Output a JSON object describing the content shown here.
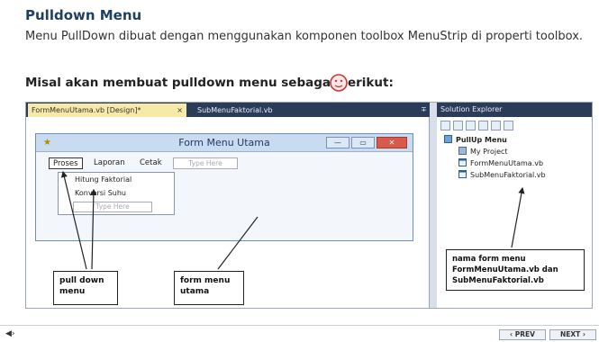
{
  "slide": {
    "title": "Pulldown Menu",
    "text": "Menu PullDown dibuat  dengan menggunakan komponen toolbox MenuStrip di properti toolbox.",
    "subheading": "Misal akan membuat pulldown menu sebagai berikut:"
  },
  "ide": {
    "tabs": [
      {
        "label": "FormMenuUtama.vb [Design]*",
        "close": "×"
      },
      {
        "label": "SubMenuFaktorial.vb"
      }
    ],
    "pin": "∓",
    "form": {
      "title": "Form Menu Utama",
      "buttons": {
        "minimize": "—",
        "maximize": "▭",
        "close": "✕"
      },
      "menubar": [
        "Proses",
        "Laporan",
        "Cetak",
        "Type Here"
      ],
      "dropdown": [
        "Hitung Faktorial",
        "Konversi Suhu",
        "Type Here"
      ]
    },
    "solution_explorer": {
      "title": "Solution Explorer",
      "project": "PullUp Menu",
      "items": [
        "My Project",
        "FormMenuUtama.vb",
        "SubMenuFaktorial.vb"
      ]
    }
  },
  "callouts": {
    "pulldown": "pull down menu",
    "form_utama": "form menu utama",
    "nama_form": "nama form menu FormMenuUtama.vb dan SubMenuFaktorial.vb"
  },
  "footer": {
    "speaker": "◀›",
    "prev": "‹ PREV",
    "next": "NEXT ›"
  },
  "colors": {
    "title": "#1f3f5f",
    "tab_bar": "#2b3c59",
    "active_tab": "#f7e9a8",
    "form_titlebar": "#c9dbf1",
    "close_button": "#d85a4a"
  }
}
